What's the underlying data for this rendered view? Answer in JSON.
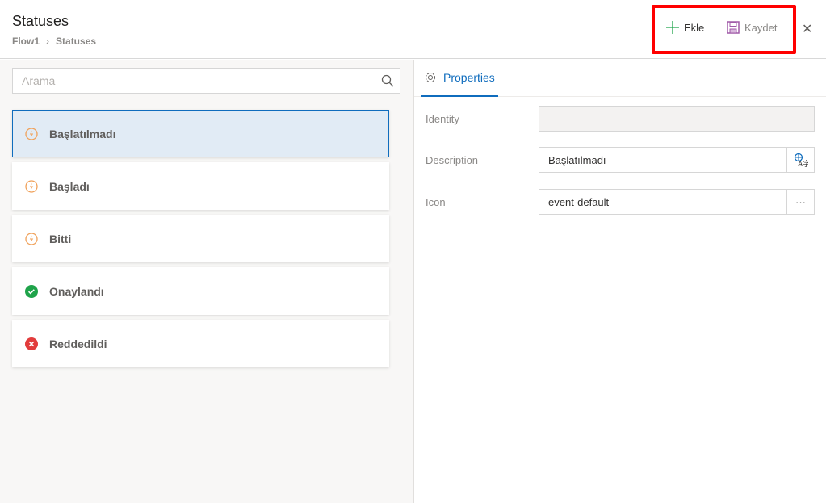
{
  "header": {
    "title": "Statuses",
    "breadcrumb": [
      "Flow1",
      "Statuses"
    ],
    "breadcrumb_sep": "›",
    "add_label": "Ekle",
    "save_label": "Kaydet",
    "close_glyph": "✕"
  },
  "search": {
    "placeholder": "Arama",
    "value": ""
  },
  "statuses": [
    {
      "label": "Başlatılmadı",
      "icon": "event-default",
      "selected": true
    },
    {
      "label": "Başladı",
      "icon": "event-default"
    },
    {
      "label": "Bitti",
      "icon": "event-default"
    },
    {
      "label": "Onaylandı",
      "icon": "check-circle"
    },
    {
      "label": "Reddedildi",
      "icon": "error-circle"
    }
  ],
  "properties": {
    "tab_label": "Properties",
    "identity": {
      "label": "Identity",
      "value": ""
    },
    "description": {
      "label": "Description",
      "value": "Başlatılmadı"
    },
    "icon": {
      "label": "Icon",
      "value": "event-default",
      "button": "···"
    }
  },
  "colors": {
    "accent": "#0f6cbd",
    "event": "#f0a15a",
    "success": "#1fa34a",
    "error": "#e23c3c",
    "highlight": "#ff0000"
  }
}
